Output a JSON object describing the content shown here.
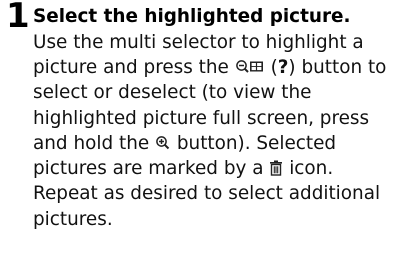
{
  "step": {
    "number": "1",
    "heading": "Select the highlighted picture.",
    "lines": {
      "l1": "Use the multi selector to highlight a",
      "l2_before": "picture and press the ",
      "l2_open_paren": " (",
      "l2_question": "?",
      "l2_after": ") button to",
      "l3": "select or deselect (to view the",
      "l4": "highlighted picture full screen, press",
      "l5_before": "and hold the ",
      "l5_after": " button).  Selected",
      "l6_before": "pictures are marked by a ",
      "l6_after": " icon.",
      "l7": "Repeat as desired to select additional",
      "l8": "pictures."
    }
  },
  "icons": {
    "thumbnail_zoom_button": "zoom-out-thumbnail-icon",
    "zoom_button": "zoom-in-icon",
    "selected_mark": "trash-icon"
  }
}
